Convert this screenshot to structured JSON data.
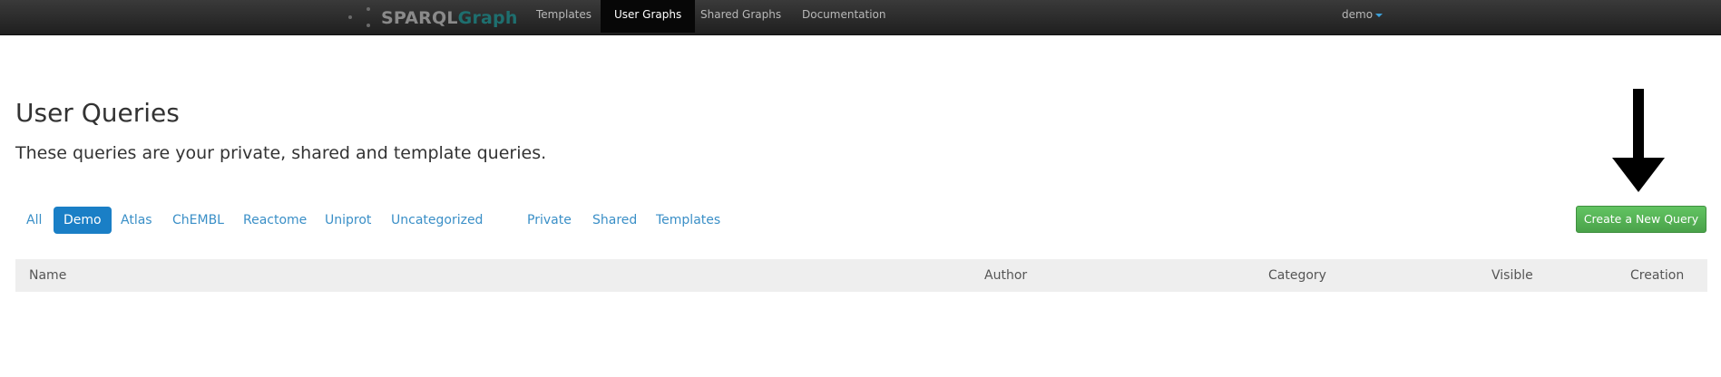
{
  "navbar": {
    "brand_part1": "SPARQL",
    "brand_part2": "Graph",
    "items": [
      {
        "label": "Templates"
      },
      {
        "label": "User Graphs"
      },
      {
        "label": "Shared Graphs"
      },
      {
        "label": "Documentation"
      }
    ],
    "active_index": 1,
    "user": "demo"
  },
  "header": {
    "title": "User Queries",
    "subtitle": "These queries are your private, shared and template queries."
  },
  "filters": {
    "categories": [
      "All",
      "Demo",
      "Atlas",
      "ChEMBL",
      "Reactome",
      "Uniprot",
      "Uncategorized"
    ],
    "active_category": "Demo",
    "visibility": [
      "Private",
      "Shared",
      "Templates"
    ]
  },
  "create_button": {
    "label": "Create a New Query"
  },
  "table": {
    "columns": [
      "Name",
      "Author",
      "Category",
      "Visible",
      "Creation"
    ],
    "rows": []
  },
  "annotation": {
    "arrow_icon": "down-arrow-icon"
  },
  "colors": {
    "navbar_bg": "#2b2b2b",
    "link": "#3a8fc7",
    "active_pill": "#1a7fc6",
    "create_button": "#55b055",
    "brand_accent": "#1e6f6f"
  }
}
